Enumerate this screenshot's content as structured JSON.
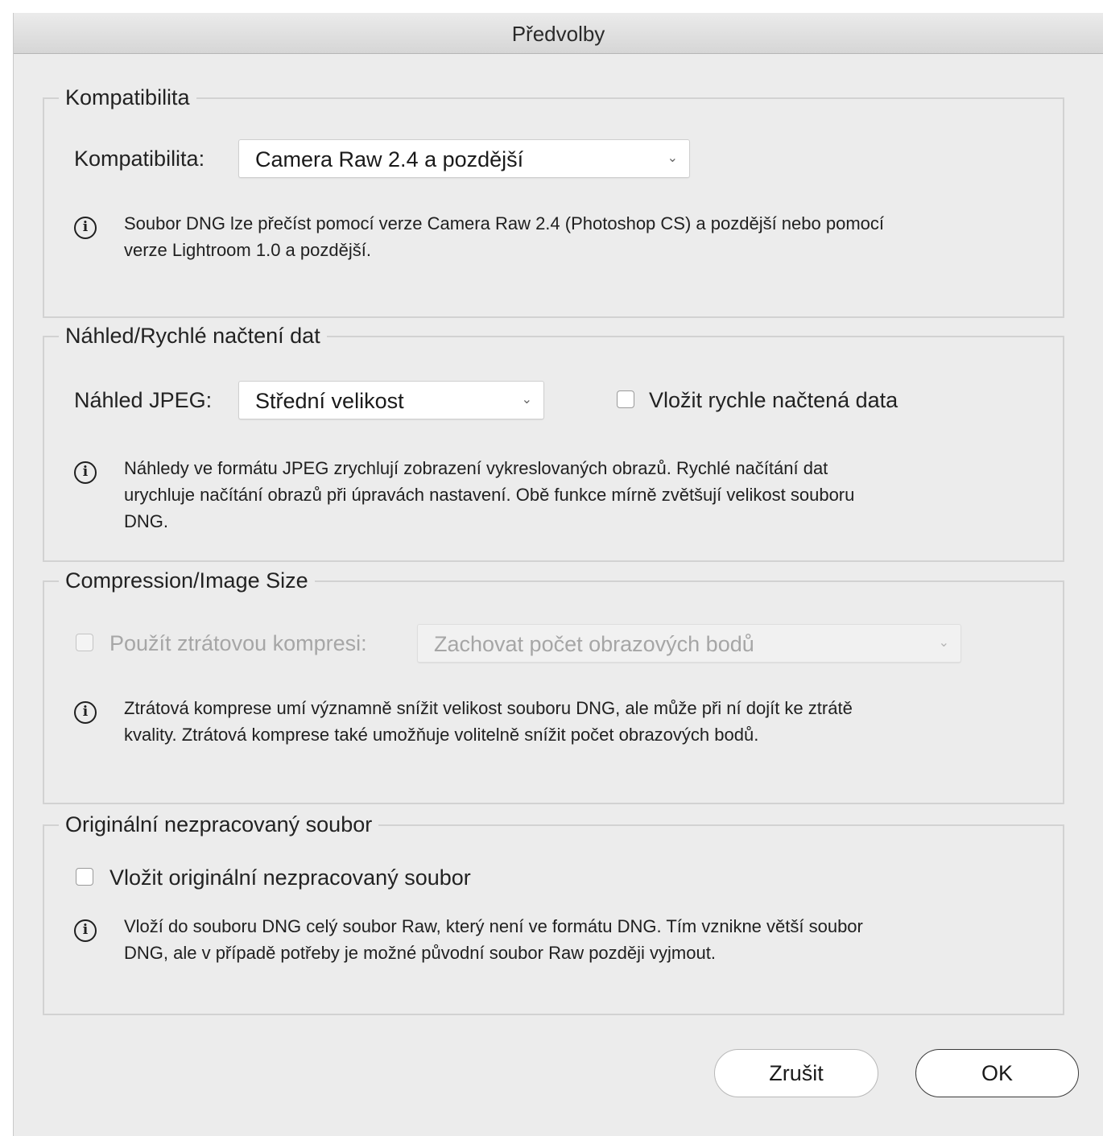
{
  "window": {
    "title": "Předvolby"
  },
  "compat": {
    "legend": "Kompatibilita",
    "label": "Kompatibilita:",
    "select_value": "Camera Raw 2.4 a pozdější",
    "info_lines": [
      "Soubor DNG lze přečíst pomocí verze Camera Raw 2.4 (Photoshop CS) a pozdější nebo pomocí",
      "verze Lightroom 1.0 a pozdější."
    ]
  },
  "preview": {
    "legend": "Náhled/Rychlé načtení dat",
    "label": "Náhled JPEG:",
    "select_value": "Střední velikost",
    "checkbox_label": "Vložit rychle načtená data",
    "checkbox_checked": false,
    "info_lines": [
      "Náhledy ve formátu JPEG zrychlují zobrazení vykreslovaných obrazů.  Rychlé načítání dat",
      "urychluje načítání obrazů při úpravách nastavení.  Obě funkce mírně zvětšují velikost souboru",
      "DNG."
    ]
  },
  "compression": {
    "legend": "Compression/Image Size",
    "checkbox_label": "Použít ztrátovou kompresi:",
    "checkbox_checked": false,
    "select_value": "Zachovat počet obrazových bodů",
    "info_lines": [
      "Ztrátová komprese umí významně snížit velikost souboru DNG, ale může při ní dojít ke ztrátě",
      "kvality.  Ztrátová komprese také umožňuje volitelně snížit počet obrazových bodů."
    ]
  },
  "original": {
    "legend": "Originální nezpracovaný soubor",
    "checkbox_label": "Vložit originální nezpracovaný soubor",
    "checkbox_checked": false,
    "info_lines": [
      "Vloží do souboru DNG celý soubor Raw, který není ve formátu DNG.  Tím vznikne větší soubor",
      "DNG, ale v případě potřeby je možné původní soubor Raw později vyjmout."
    ]
  },
  "buttons": {
    "cancel": "Zrušit",
    "ok": "OK"
  },
  "icons": {
    "info": "info-icon",
    "chevron": "chevron-down-icon"
  }
}
